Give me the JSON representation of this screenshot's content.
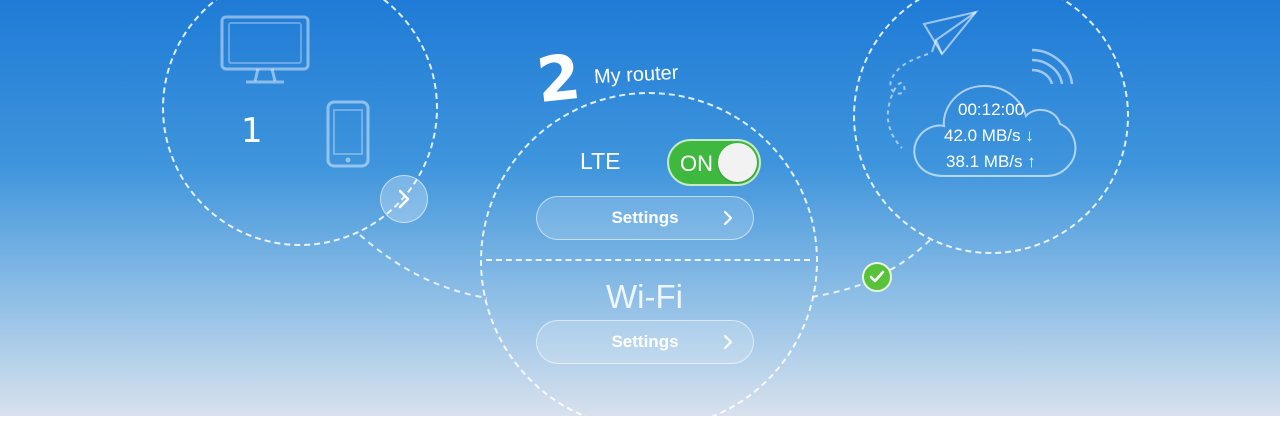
{
  "step1": {
    "number": "1"
  },
  "step2": {
    "number": "2",
    "label": "My router"
  },
  "lte": {
    "label": "LTE",
    "toggle_state": "ON",
    "settings_label": "Settings"
  },
  "wifi": {
    "label": "Wi-Fi",
    "settings_label": "Settings"
  },
  "stats": {
    "connected_time": "00:12:00",
    "download": "42.0 MB/s ↓",
    "upload": "38.1 MB/s ↑"
  },
  "icons": [
    "monitor-icon",
    "phone-icon",
    "chevron-right-icon",
    "paper-plane-icon",
    "signal-wave-icon",
    "cloud-icon",
    "checkmark-icon"
  ],
  "colors": {
    "toggle_on": "#3fb83f",
    "check": "#58c23a",
    "background_top": "#1f7bd6",
    "background_bottom": "#d8e1ee"
  }
}
